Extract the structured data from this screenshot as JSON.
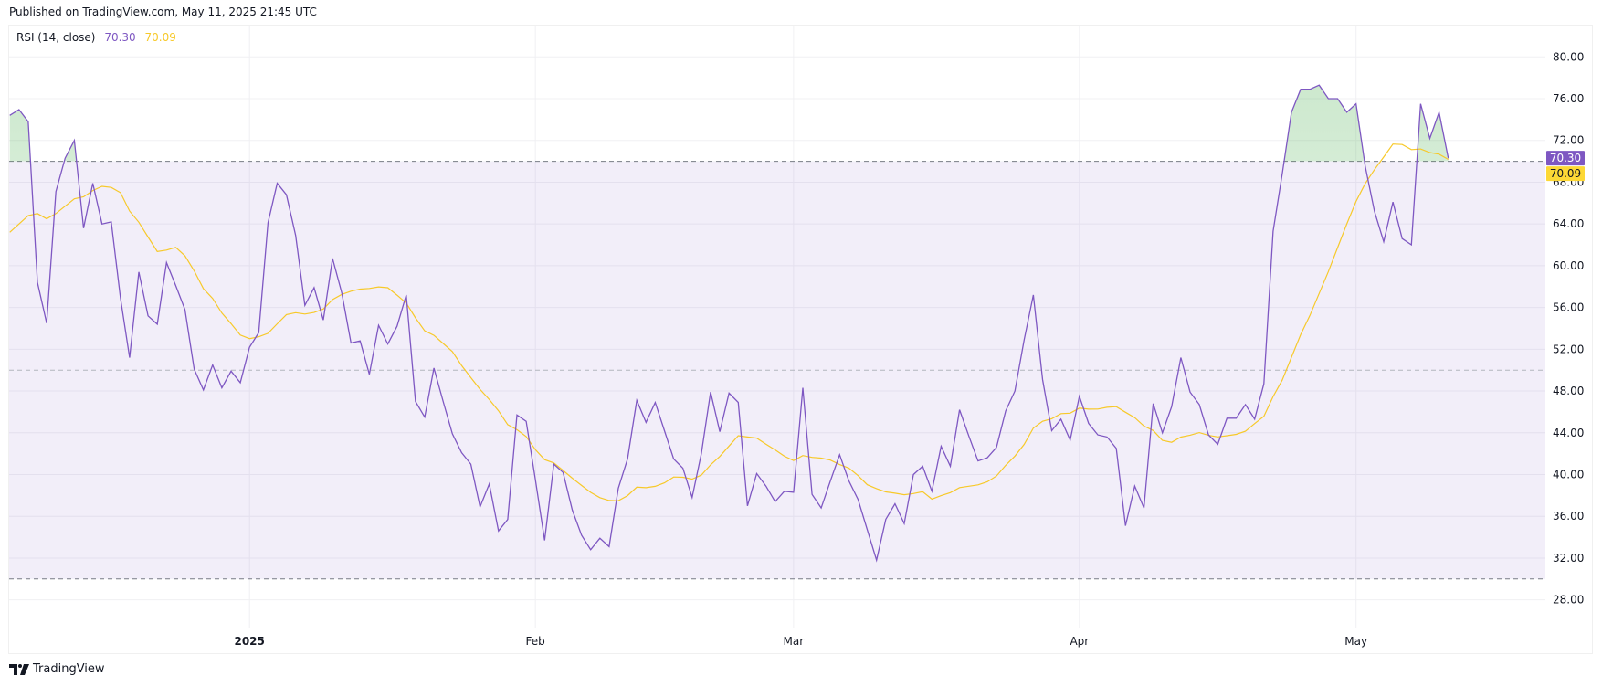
{
  "header": {
    "published": "Published on TradingView.com, May 11, 2025 21:45 UTC"
  },
  "legend": {
    "name": "RSI (14, close)",
    "rsi_value": "70.30",
    "ma_value": "70.09"
  },
  "brand": {
    "name": "TradingView"
  },
  "colors": {
    "rsi": "#7e57c2",
    "ma": "#f7c92a",
    "band": "#7e57c2",
    "overbought_fill": "#4caf50"
  },
  "chart_data": {
    "type": "line",
    "title": "RSI (14, close)",
    "x_start_date": "2024-12-06",
    "x_end_date": "2025-05-11",
    "x_tick_labels": [
      {
        "label": "2025",
        "index": 26,
        "bold": true
      },
      {
        "label": "Feb",
        "index": 57
      },
      {
        "label": "Mar",
        "index": 85
      },
      {
        "label": "Apr",
        "index": 116
      },
      {
        "label": "May",
        "index": 146
      }
    ],
    "y_ticks": [
      "80.00",
      "76.00",
      "72.00",
      "68.00",
      "64.00",
      "60.00",
      "56.00",
      "52.00",
      "48.00",
      "44.00",
      "40.00",
      "36.00",
      "32.00",
      "28.00"
    ],
    "ylim": [
      23.6,
      85
    ],
    "bands": {
      "upper": 70,
      "middle": 50,
      "lower": 30
    },
    "series": [
      {
        "name": "RSI",
        "values": [
          74.4,
          74.95,
          73.8,
          58.4,
          54.5,
          67.1,
          70.3,
          72.0,
          63.6,
          67.9,
          64.0,
          64.2,
          56.9,
          51.2,
          59.4,
          55.2,
          54.4,
          60.3,
          58.1,
          55.8,
          50.1,
          48.1,
          50.5,
          48.3,
          49.9,
          48.8,
          52.2,
          53.6,
          64.1,
          67.9,
          66.8,
          62.9,
          56.2,
          57.9,
          54.8,
          60.7,
          57.4,
          52.6,
          52.8,
          49.6,
          54.3,
          52.5,
          54.2,
          57.2,
          47.0,
          45.5,
          50.2,
          47.0,
          43.9,
          42.1,
          41.0,
          36.9,
          39.1,
          34.6,
          35.7,
          45.7,
          45.1,
          39.5,
          33.7,
          41.0,
          40.2,
          36.6,
          34.2,
          32.8,
          33.9,
          33.1,
          38.7,
          41.5,
          47.1,
          45.0,
          46.9,
          44.2,
          41.5,
          40.6,
          37.8,
          42.0,
          47.9,
          44.1,
          47.8,
          46.9,
          37.0,
          40.1,
          38.9,
          37.4,
          38.4,
          38.3,
          48.3,
          38.1,
          36.8,
          39.4,
          41.9,
          39.4,
          37.6,
          34.7,
          31.8,
          35.7,
          37.2,
          35.3,
          40.0,
          40.8,
          38.4,
          42.7,
          40.8,
          46.2,
          43.7,
          41.3,
          41.6,
          42.6,
          46.1,
          48.0,
          52.9,
          57.2,
          49.1,
          44.2,
          45.3,
          43.3,
          47.5,
          44.9,
          43.8,
          43.6,
          42.5,
          35.1,
          38.9,
          36.8,
          46.8,
          44.0,
          46.5,
          51.2,
          47.9,
          46.7,
          43.8,
          42.9,
          45.4,
          45.4,
          46.7,
          45.3,
          48.7,
          63.3,
          68.8,
          74.7,
          76.9,
          76.9,
          77.3,
          76.0,
          76.0,
          74.7,
          75.5,
          69.5,
          65.2,
          62.3,
          66.1,
          62.6,
          62.0,
          75.5,
          72.2,
          74.7,
          70.3
        ]
      },
      {
        "name": "RSI-based MA",
        "sma_length": 14,
        "leading_values": [
          63.2,
          64.0,
          64.8,
          65.0,
          64.5,
          65.0,
          65.7,
          66.4,
          66.6,
          67.2,
          67.6,
          67.5,
          67.0
        ]
      }
    ],
    "last_values": {
      "rsi": "70.30",
      "ma": "70.09"
    }
  }
}
